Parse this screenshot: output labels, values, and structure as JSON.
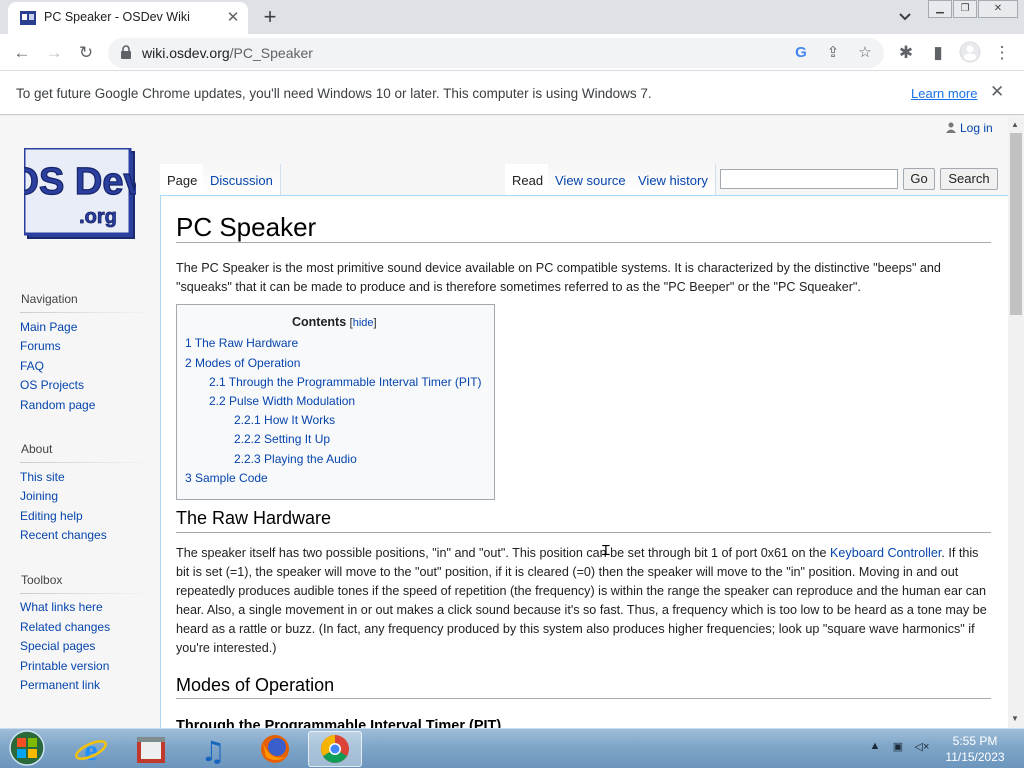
{
  "browser": {
    "tab_title": "PC Speaker - OSDev Wiki",
    "tab_close": "✕",
    "new_tab": "+",
    "url_host": "wiki.osdev.org",
    "url_path": "/PC_Speaker"
  },
  "infobar": {
    "message": "To get future Google Chrome updates, you'll need Windows 10 or later. This computer is using Windows 7.",
    "learn_more": "Learn more",
    "close": "✕"
  },
  "wiki": {
    "login": "Log in",
    "logo_top": "OS Dev",
    "logo_bottom": ".org",
    "tabs": {
      "page": "Page",
      "discussion": "Discussion",
      "read": "Read",
      "view_source": "View source",
      "view_history": "View history"
    },
    "search_placeholder": "",
    "go": "Go",
    "search": "Search",
    "navigation": {
      "heading": "Navigation",
      "items": [
        "Main Page",
        "Forums",
        "FAQ",
        "OS Projects",
        "Random page"
      ]
    },
    "about": {
      "heading": "About",
      "items": [
        "This site",
        "Joining",
        "Editing help",
        "Recent changes"
      ]
    },
    "toolbox": {
      "heading": "Toolbox",
      "items": [
        "What links here",
        "Related changes",
        "Special pages",
        "Printable version",
        "Permanent link"
      ]
    }
  },
  "article": {
    "title": "PC Speaker",
    "intro": "The PC Speaker is the most primitive sound device available on PC compatible systems. It is characterized by the distinctive \"beeps\" and \"squeaks\" that it can be made to produce and is therefore sometimes referred to as the \"PC Beeper\" or the \"PC Squeaker\".",
    "toc": {
      "title": "Contents",
      "hide_open": "[",
      "hide": "hide",
      "hide_close": "]",
      "items": [
        "1 The Raw Hardware",
        "2 Modes of Operation",
        "2.1 Through the Programmable Interval Timer (PIT)",
        "2.2 Pulse Width Modulation",
        "2.2.1 How It Works",
        "2.2.2 Setting It Up",
        "2.2.3 Playing the Audio",
        "3 Sample Code"
      ]
    },
    "section1_title": "The Raw Hardware",
    "section1_p1": "The speaker itself has two possible positions, \"in\" and \"out\". This position can be set through bit 1 of port 0x61 on the ",
    "section1_link": "Keyboard Controller",
    "section1_p2": ". If this bit is set (=1), the speaker will move to the \"out\" position, if it is cleared (=0) then the speaker will move to the \"in\" position. Moving in and out repeatedly produces audible tones if the speed of repetition (the frequency) is within the range the speaker can reproduce and the human ear can hear. Also, a single movement in or out makes a click sound because it's so fast. Thus, a frequency which is too low to be heard as a tone may be heard as a rattle or buzz. (In fact, any frequency produced by this system also produces higher frequencies; look up \"square wave harmonics\" if you're interested.)",
    "section2_title": "Modes of Operation",
    "section3_title": "Through the Programmable Interval Timer (PIT)"
  },
  "taskbar": {
    "time": "5:55 PM",
    "date": "11/15/2023"
  }
}
